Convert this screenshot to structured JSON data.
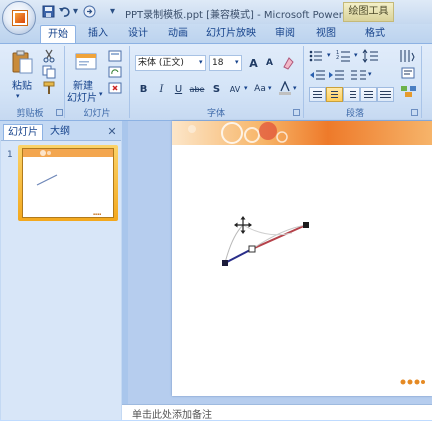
{
  "app": {
    "title": "PPT录制模板.ppt [兼容模式] - Microsoft PowerP",
    "context_tab": "绘图工具"
  },
  "quick_access": {
    "save": "save-icon",
    "undo": "undo-icon",
    "redo": "redo-icon",
    "customize": "dropdown-icon"
  },
  "tabs": [
    {
      "label": "开始",
      "active": true
    },
    {
      "label": "插入"
    },
    {
      "label": "设计"
    },
    {
      "label": "动画"
    },
    {
      "label": "幻灯片放映"
    },
    {
      "label": "审阅"
    },
    {
      "label": "视图"
    },
    {
      "label": "格式"
    }
  ],
  "ribbon": {
    "clipboard": {
      "label": "剪贴板",
      "paste": "粘贴"
    },
    "slides": {
      "label": "幻灯片",
      "new_slide_line1": "新建",
      "new_slide_line2": "幻灯片"
    },
    "font": {
      "label": "字体",
      "font_name": "宋体 (正文)",
      "font_size": "18",
      "bold": "B",
      "italic": "I",
      "underline": "U",
      "strike": "abe",
      "shadow": "S",
      "spacing": "AV",
      "case": "Aa",
      "grow": "A",
      "shrink": "A"
    },
    "paragraph": {
      "label": "段落"
    }
  },
  "left_pane": {
    "tab_slides": "幻灯片",
    "tab_outline": "大纲",
    "slide_number": "1"
  },
  "notes": {
    "placeholder": "单击此处添加备注"
  },
  "colors": {
    "accent": "#15428b",
    "curve_segment_1": "#2a2e8a",
    "curve_segment_2": "#b5424a",
    "slide_banner": "#ee7a2a"
  }
}
